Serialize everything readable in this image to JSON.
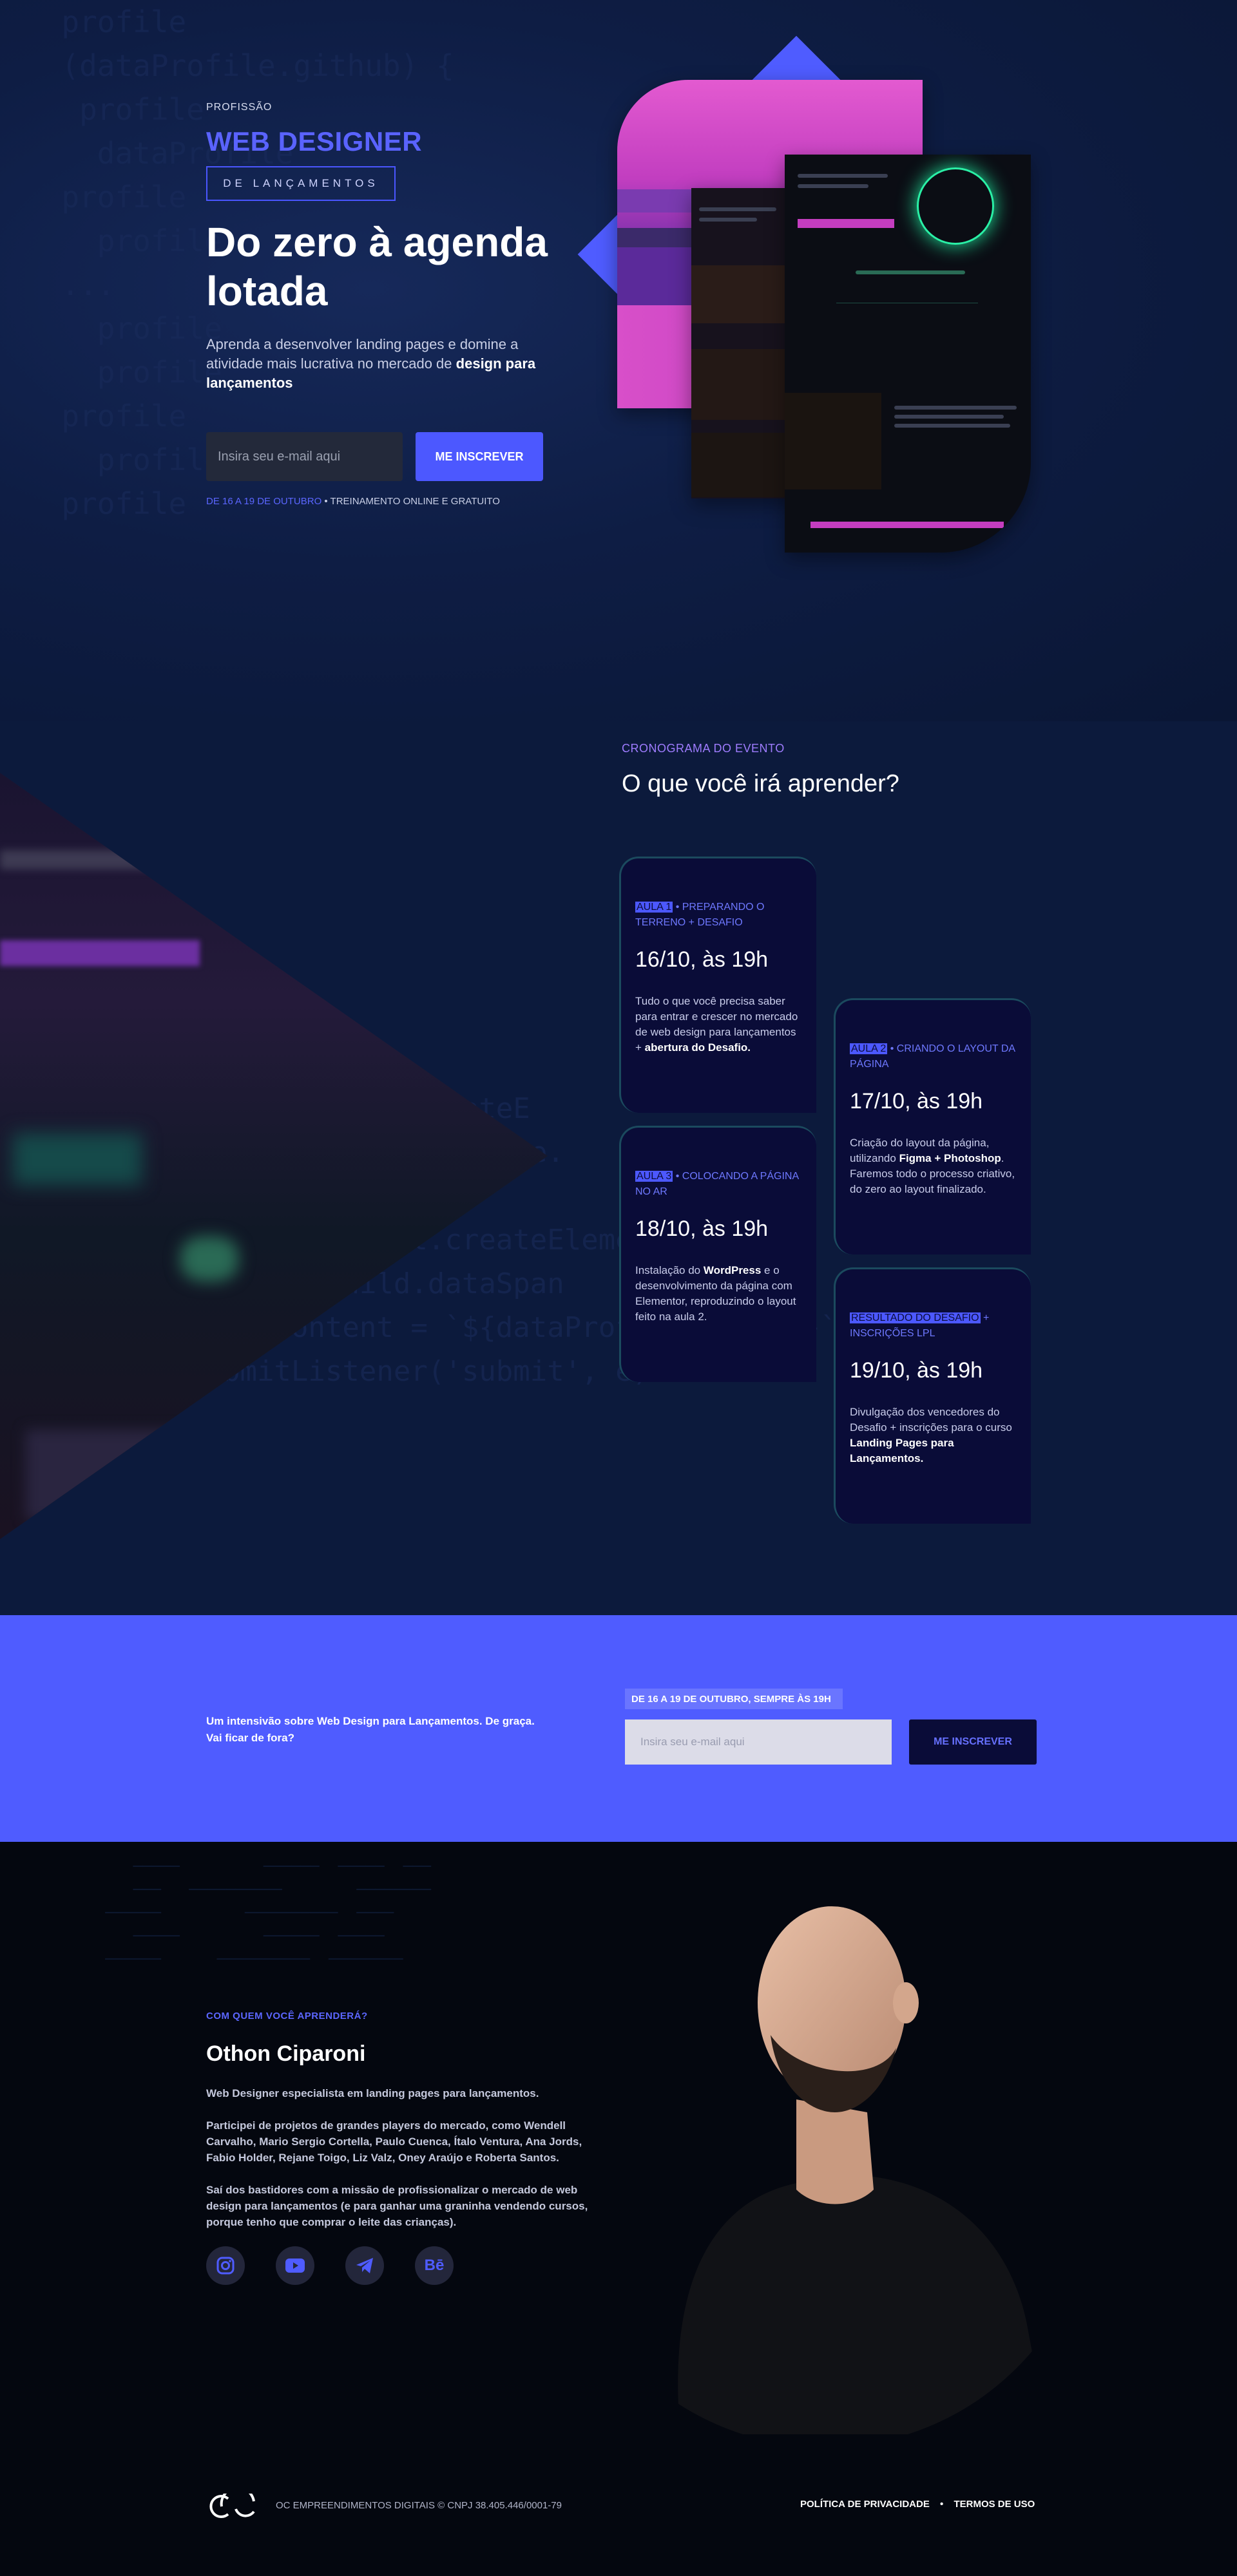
{
  "hero": {
    "profession_label": "PROFISSÃO",
    "role": "WEB DESIGNER",
    "role_sub": "DE LANÇAMENTOS",
    "headline": "Do zero à agenda lotada",
    "description_start": "Aprenda a desenvolver landing pages e domine a atividade mais lucrativa no mercado de ",
    "description_bold": "design para lançamentos",
    "email_placeholder": "Insira seu e-mail aqui",
    "cta_label": "ME INSCREVER",
    "date_highlight": "DE 16 A 19 DE OUTUBRO",
    "date_rest": " • TREINAMENTO ONLINE E GRATUITO"
  },
  "schedule": {
    "kicker": "CRONOGRAMA DO EVENTO",
    "title": "O que você irá aprender?",
    "cards": [
      {
        "tag_hl": "AULA 1",
        "tag_rest": " • PREPARANDO O TERRENO + DESAFIO",
        "date": "16/10, às 19h",
        "text_a": "Tudo o que você precisa saber para entrar e crescer no mercado de web design para lançamentos + ",
        "text_b": "abertura do Desafio.",
        "text_c": ""
      },
      {
        "tag_hl": "AULA 2",
        "tag_rest": " • CRIANDO O LAYOUT DA PÁGINA",
        "date": "17/10, às 19h",
        "text_a": "Criação do layout da página, utilizando ",
        "text_b": "Figma + Photoshop",
        "text_c": ". Faremos todo o processo criativo, do zero ao layout finalizado."
      },
      {
        "tag_hl": "AULA 3",
        "tag_rest": " • COLOCANDO A PÁGINA NO AR",
        "date": "18/10, às 19h",
        "text_a": "Instalação do ",
        "text_b": "WordPress",
        "text_c": " e o desenvolvimento da página com Elementor, reproduzindo o layout feito na aula 2."
      },
      {
        "tag_hl": "RESULTADO DO DESAFIO",
        "tag_rest": " + INSCRIÇÕES LPL",
        "date": "19/10, às 19h",
        "text_a": "Divulgação dos vencedores do Desafio + inscrições para o curso ",
        "text_b": "Landing Pages para Lançamentos.",
        "text_c": ""
      }
    ]
  },
  "band": {
    "text": "Um intensivão sobre Web Design para Lançamentos. De graça. Vai ficar de fora?",
    "date": "DE 16 A 19 DE OUTUBRO, SEMPRE ÀS 19H",
    "email_placeholder": "Insira seu e-mail aqui",
    "cta_label": "ME INSCREVER"
  },
  "about": {
    "kicker": "COM QUEM VOCÊ APRENDERÁ?",
    "name": "Othon Ciparoni",
    "p1": "Web Designer especialista em landing pages para lançamentos.",
    "p2": "Participei de projetos de grandes players do mercado, como Wendell Carvalho, Mario Sergio Cortella, Paulo Cuenca, Ítalo Ventura, Ana Jords, Fabio Holder, Rejane Toigo, Liz Valz, Oney Araújo e Roberta Santos.",
    "p3": "Saí dos bastidores com a missão de profissionalizar o mercado de web design para lançamentos (e para ganhar uma graninha vendendo cursos, porque tenho que comprar o leite das crianças).",
    "socials": [
      {
        "icon": "instagram-icon"
      },
      {
        "icon": "youtube-icon"
      },
      {
        "icon": "telegram-icon"
      },
      {
        "icon": "behance-icon",
        "label": "Bē"
      }
    ]
  },
  "footer": {
    "copyright": "OC EMPREENDIMENTOS DIGITAIS © CNPJ 38.405.446/0001-79",
    "privacy": "POLÍTICA DE PRIVACIDADE",
    "separator": "•",
    "terms": "TERMOS DE USO"
  },
  "colors": {
    "accent": "#4f5cff",
    "dark": "#0a0c38",
    "bg": "#0c1a3c"
  }
}
